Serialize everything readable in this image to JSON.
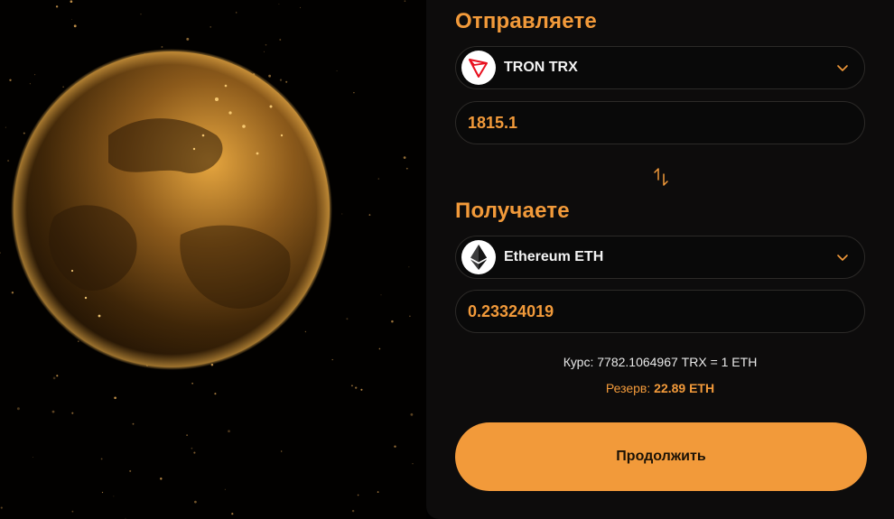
{
  "send": {
    "title": "Отправляете",
    "currency": "TRON TRX",
    "amount": "1815.1",
    "icon": "tron-logo-icon"
  },
  "receive": {
    "title": "Получаете",
    "currency": "Ethereum ETH",
    "amount": "0.23324019",
    "icon": "ethereum-logo-icon"
  },
  "rate": {
    "text": "Курс: 7782.1064967 TRX = 1 ETH",
    "reserve_label": "Резерв:",
    "reserve_value": "22.89 ETH"
  },
  "continue_label": "Продолжить",
  "colors": {
    "accent": "#f29a3a",
    "panel": "#0d0c0c",
    "tron_red": "#e8101f"
  }
}
